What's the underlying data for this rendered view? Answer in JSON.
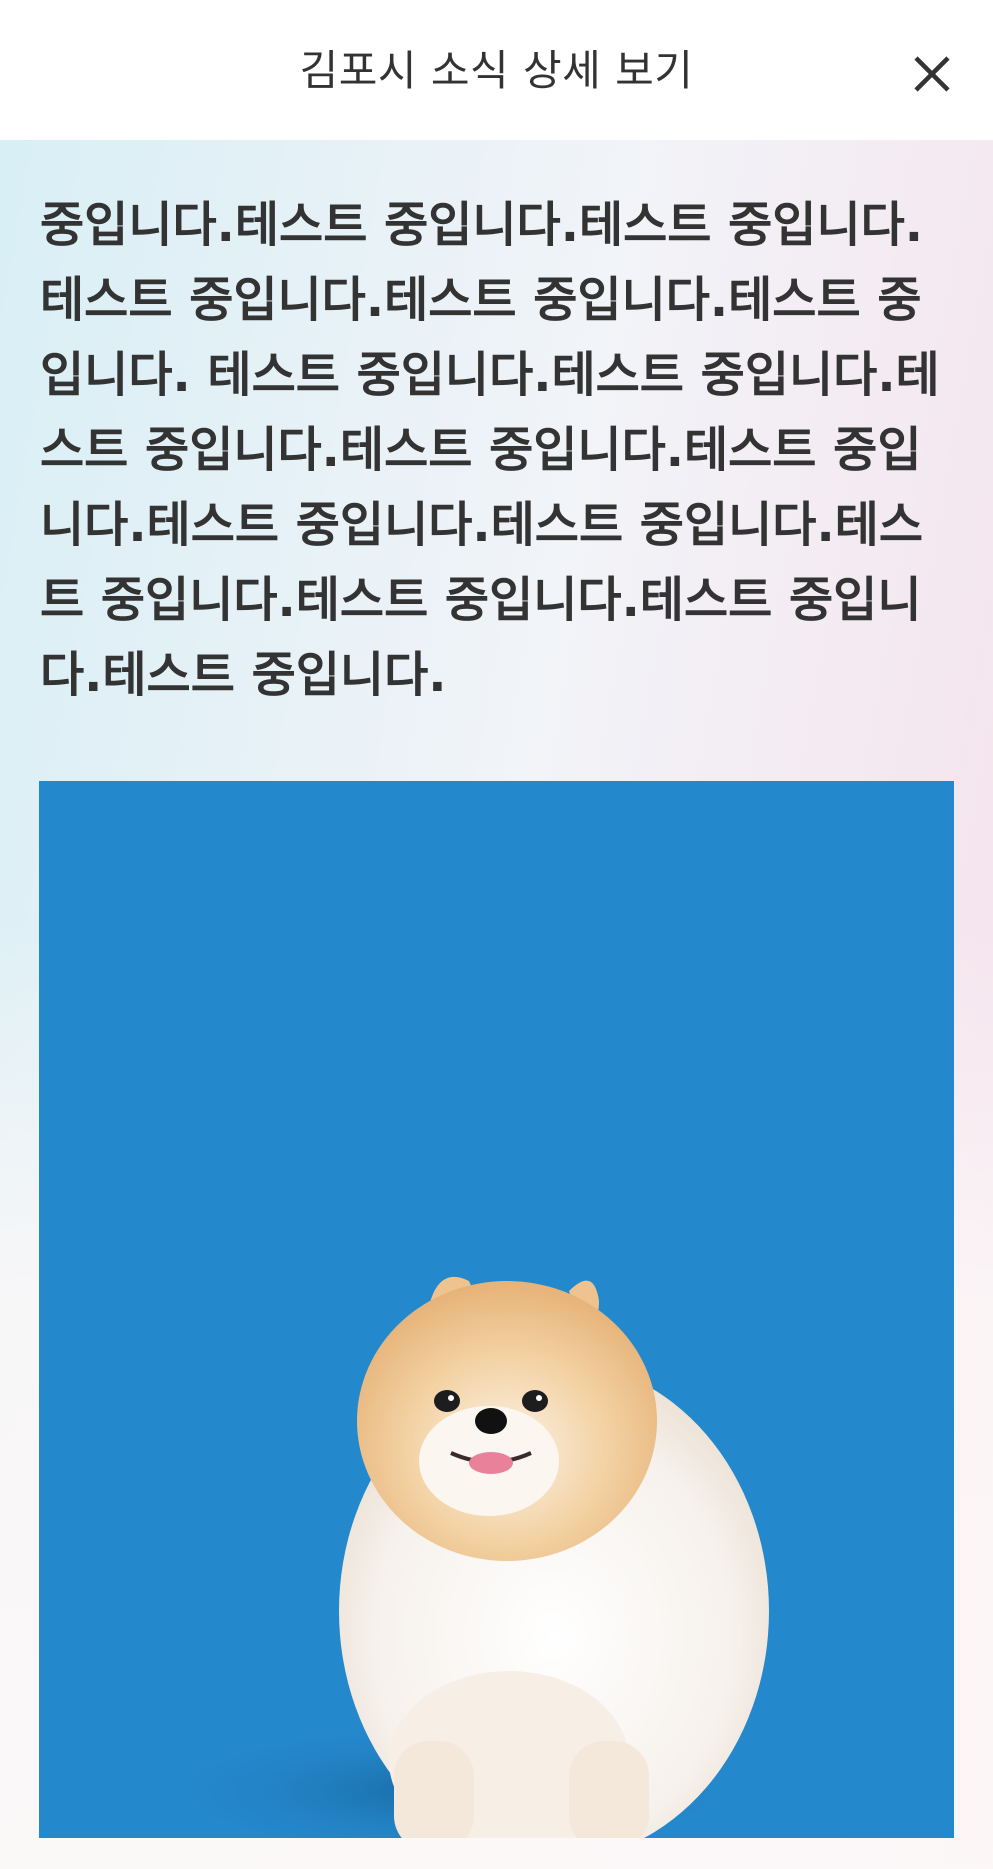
{
  "header": {
    "title": "김포시 소식 상세 보기",
    "close_icon": "close-icon"
  },
  "article": {
    "body": "중입니다.테스트 중입니다.테스트 중입니다.테스트 중입니다.테스트 중입니다.테스트 중입니다. 테스트 중입니다.테스트 중입니다.테스트 중입니다.테스트 중입니다.테스트 중입니다.테스트 중입니다.테스트 중입니다.테스트 중입니다.테스트 중입니다.테스트 중입니다.테스트 중입니다.",
    "image_subject": "pomeranian-dog-photo"
  },
  "colors": {
    "photo_background": "#2488cc",
    "text": "#333333"
  }
}
